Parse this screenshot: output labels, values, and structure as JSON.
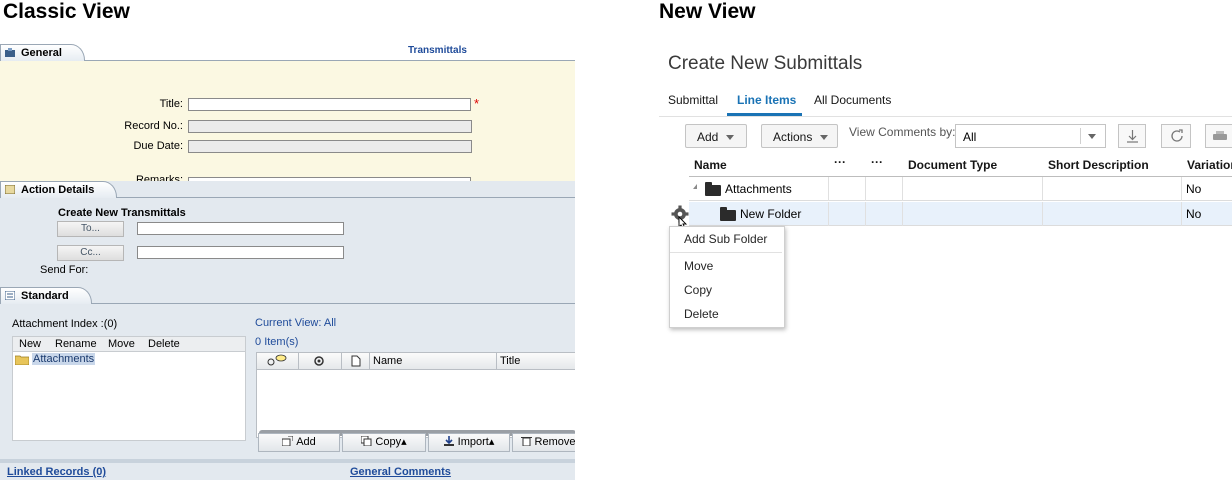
{
  "headings": {
    "classic": "Classic View",
    "new": "New View"
  },
  "classic": {
    "general_tab": "General",
    "transmittals_title": "Transmittals",
    "fields": {
      "title": "Title:",
      "record_no": "Record No.:",
      "due_date": "Due Date:",
      "remarks_partial": "Remarks:",
      "required_mark": "*"
    },
    "action_tab": "Action Details",
    "create_new": "Create New Transmittals",
    "to_button": "To...",
    "cc_button": "Cc...",
    "send_for": "Send For:",
    "standard_tab": "Standard",
    "attachment_index": "Attachment Index :(0)",
    "tree_actions": [
      "New",
      "Rename",
      "Move",
      "Delete"
    ],
    "tree_root": "Attachments",
    "current_view_label": "Current View:",
    "current_view_value": "All",
    "item_count": "0",
    "item_label": "Item(s)",
    "columns": {
      "name": "Name",
      "title": "Title"
    },
    "toolbar": {
      "add": "Add",
      "copy": "Copy▴",
      "import": "Import▴",
      "remove": "Remove"
    },
    "linked_records": "Linked Records (0)",
    "general_comments": "General Comments"
  },
  "new_view": {
    "page_title": "Create New Submittals",
    "tabs": [
      "Submittal",
      "Line Items",
      "All Documents"
    ],
    "active_tab": "Line Items",
    "add_button": "Add",
    "actions_button": "Actions",
    "view_comments_label": "View Comments by:",
    "view_comments_value": "All",
    "columns": {
      "name": "Name",
      "dots1": "···",
      "dots2": "···",
      "document_type": "Document Type",
      "short_description": "Short Description",
      "variation": "Variation"
    },
    "rows": [
      {
        "name": "Attachments",
        "variation": "No"
      },
      {
        "name": "New Folder",
        "variation": "No"
      }
    ],
    "context_menu": [
      "Add Sub Folder",
      "Move",
      "Copy",
      "Delete"
    ],
    "colors": {
      "accent": "#1a73b5",
      "text": "#161616",
      "selected_row": "#e8f1fb"
    }
  }
}
